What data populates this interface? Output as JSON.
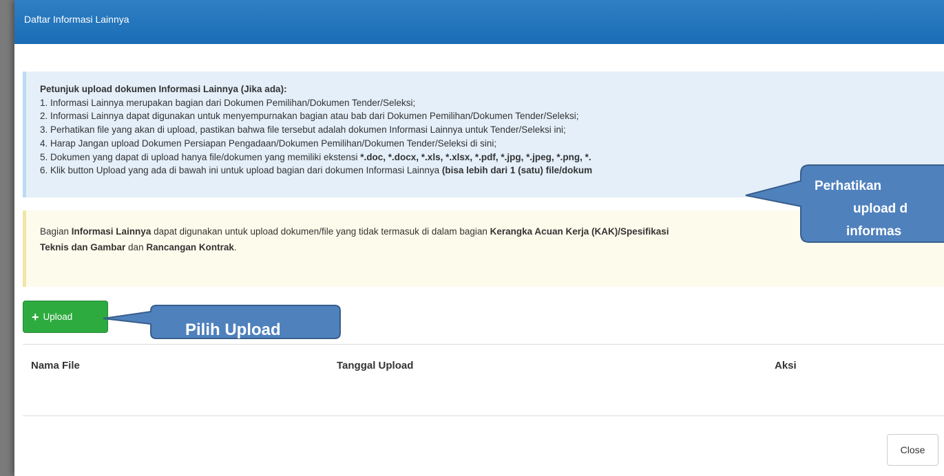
{
  "modal": {
    "title": "Daftar Informasi Lainnya"
  },
  "instructions": {
    "heading": "Petunjuk upload dokumen Informasi Lainnya (Jika ada):",
    "items": [
      "1. Informasi Lainnya merupakan bagian dari Dokumen Pemilihan/Dokumen Tender/Seleksi;",
      "2. Informasi Lainnya dapat digunakan untuk menyempurnakan bagian atau bab dari Dokumen Pemilihan/Dokumen Tender/Seleksi;",
      "3. Perhatikan file yang akan di upload, pastikan bahwa file tersebut adalah dokumen Informasi Lainnya untuk Tender/Seleksi ini;",
      "4. Harap Jangan upload Dokumen Persiapan Pengadaan/Dokumen Pemilihan/Dokumen Tender/Seleksi di sini;"
    ],
    "item5_text": "5. Dokumen yang dapat di upload hanya file/dokumen yang memiliki ekstensi ",
    "item5_ext": "*.doc, *.docx, *.xls, *.xlsx, *.pdf, *.jpg, *.jpeg, *.png, *.",
    "item6_text": "6. Klik button Upload yang ada di bawah ini untuk upload bagian dari dokumen Informasi Lainnya ",
    "item6_bold": "(bisa lebih dari 1 (satu) file/dokum"
  },
  "notice": {
    "t1": "Bagian ",
    "b1": "Informasi Lainnya",
    "t2": " dapat digunakan untuk upload dokumen/file yang tidak termasuk di dalam bagian ",
    "b2": "Kerangka Acuan Kerja (KAK)/Spesifikasi",
    "b3": "Teknis dan Gambar",
    "t3": " dan ",
    "b4": "Rancangan Kontrak",
    "t4": "."
  },
  "upload_button": {
    "icon": "plus-icon",
    "label": "Upload"
  },
  "table": {
    "headers": [
      "Nama File",
      "Tanggal Upload",
      "Aksi"
    ]
  },
  "close_button": {
    "label": "Close"
  },
  "callouts": {
    "upload": "Pilih Upload",
    "notice_lines": [
      "Perhatikan",
      "upload d",
      "informas"
    ]
  },
  "colors": {
    "header_bg": "#1a6db5",
    "info_bg": "#e4eff9",
    "warning_bg": "#fdfbec",
    "upload_green": "#2eab3f",
    "callout_fill": "#4f81bd",
    "callout_stroke": "#385d8a"
  }
}
